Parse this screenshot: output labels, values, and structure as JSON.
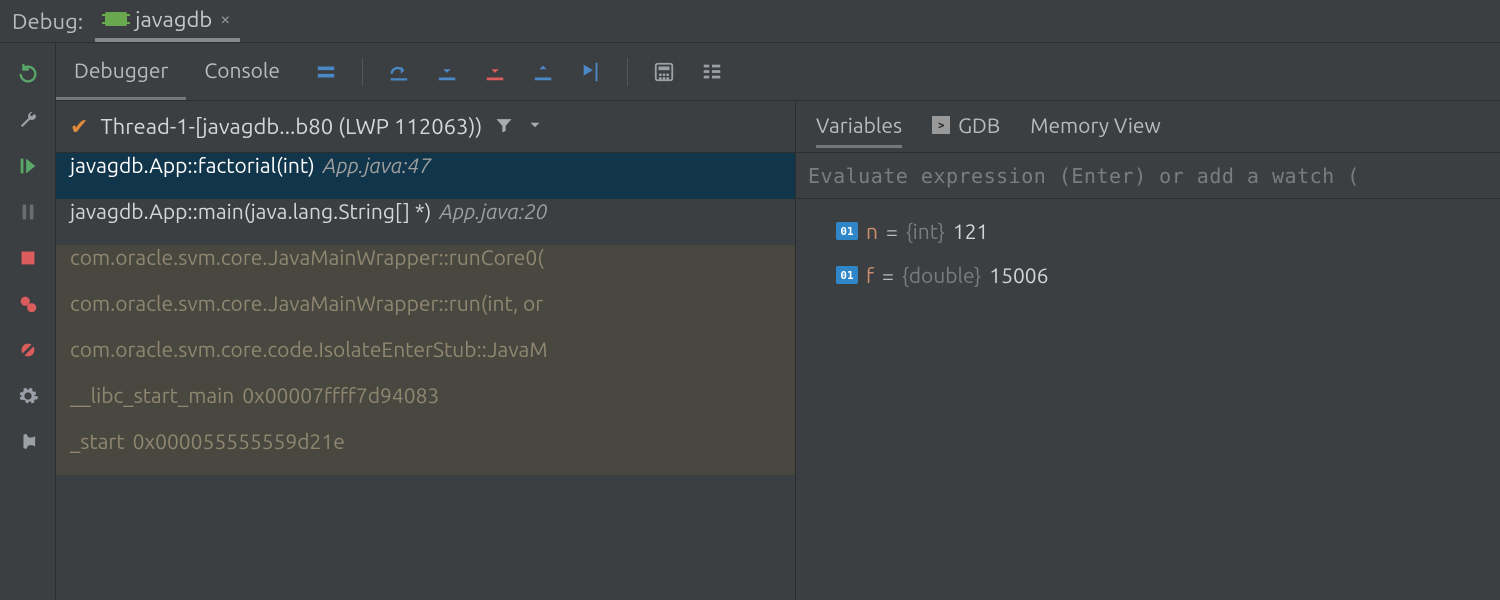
{
  "header": {
    "debug_label": "Debug:",
    "session_name": "javagdb"
  },
  "tool_tabs": {
    "debugger": "Debugger",
    "console": "Console"
  },
  "thread": {
    "name": "Thread-1-[javagdb...b80 (LWP 112063))"
  },
  "frames": [
    {
      "sig": "javagdb.App::factorial(int)",
      "loc": "App.java:47",
      "kind": "selected"
    },
    {
      "sig": "javagdb.App::main(java.lang.String[] *)",
      "loc": "App.java:20",
      "kind": "normal"
    },
    {
      "sig": "com.oracle.svm.core.JavaMainWrapper::runCore0(",
      "loc": "",
      "kind": "lib"
    },
    {
      "sig": "com.oracle.svm.core.JavaMainWrapper::run(int, or",
      "loc": "",
      "kind": "lib"
    },
    {
      "sig": "com.oracle.svm.core.code.IsolateEnterStub::JavaM",
      "loc": "",
      "kind": "lib"
    },
    {
      "sig": "__libc_start_main",
      "loc": "0x00007ffff7d94083",
      "kind": "libaddr"
    },
    {
      "sig": "_start",
      "loc": "0x000055555559d21e",
      "kind": "libaddr"
    }
  ],
  "var_tabs": {
    "variables": "Variables",
    "gdb": "GDB",
    "memory": "Memory View"
  },
  "eval_placeholder": "Evaluate expression (Enter) or add a watch (",
  "variables": [
    {
      "badge": "01",
      "name": "n",
      "type": "{int}",
      "value": "121"
    },
    {
      "badge": "01",
      "name": "f",
      "type": "{double}",
      "value": "15006"
    }
  ]
}
